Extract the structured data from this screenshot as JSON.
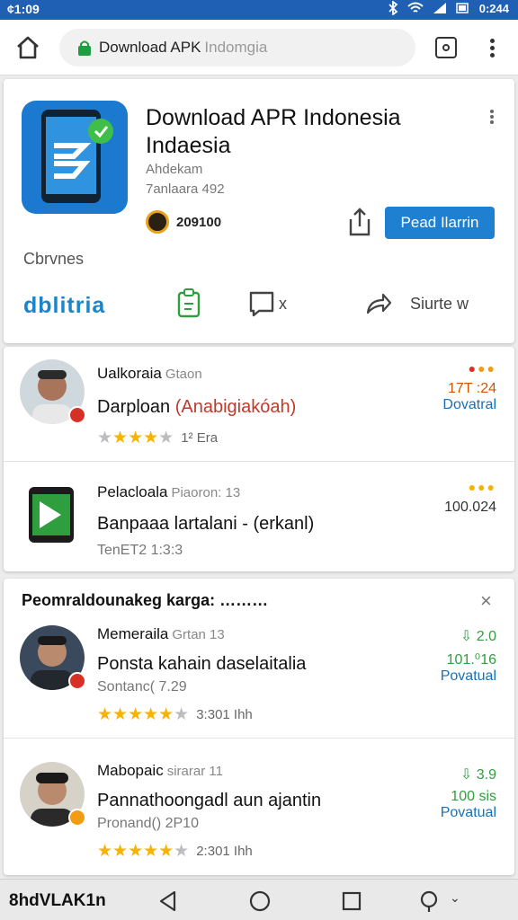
{
  "status_bar": {
    "time_left": "¢1:09",
    "time_right": "0:244"
  },
  "browser": {
    "url_main": "Download APK",
    "url_dim": "Indomgia"
  },
  "app": {
    "title": "Download APR Indonesia Indaesia",
    "developer": "Ahdekam",
    "size_info": "7anlaara 492",
    "downloads": "209100",
    "primary_button": "Pead Ilarrin",
    "browse_label": "Cbrvnes",
    "brand": "dblitria",
    "share_label": "Siurte w",
    "chat_label": "x"
  },
  "featured": {
    "rows": [
      {
        "name": "Ualkoraia",
        "name_sub": "Gtaon",
        "text": "Darploan",
        "text_accent": "(Anabigiakóah)",
        "meta": "1² Era",
        "stars": 4,
        "right_num": "17T :24",
        "right_link": "Dovatral"
      },
      {
        "name": "Pelacloala",
        "name_sub": "Piaoron: 13",
        "text": "Banpaaa lartalani - (erkanl)",
        "meta": "TenET2 1:3:3",
        "right_num": "100.024"
      }
    ]
  },
  "section": {
    "title": "Peomraldounakeg karga: ………",
    "rows": [
      {
        "name": "Memeraila",
        "name_sub": "Grtan 13",
        "text": "Ponsta kahain daselaitalia",
        "sub": "Sontanc( 7.29",
        "meta": "3:301 Ihh",
        "stars": 5,
        "score": "2.0",
        "right_num": "101.⁰16",
        "right_link": "Povatual"
      },
      {
        "name": "Mabopaic",
        "name_sub": "sirarar 11",
        "text": "Pannathoongadl aun ajantin",
        "sub": "Pronand() 2P10",
        "meta": "2:301 Ihh",
        "stars": 5,
        "score": "3.9",
        "right_num": "100 sis",
        "right_link": "Povatual"
      }
    ]
  },
  "nav": {
    "label": "8hdVLAK1n"
  },
  "colors": {
    "primary": "#1f7fd0",
    "status_bar": "#1f5fb4",
    "star": "#f4b400",
    "green": "#2e9e3f"
  }
}
